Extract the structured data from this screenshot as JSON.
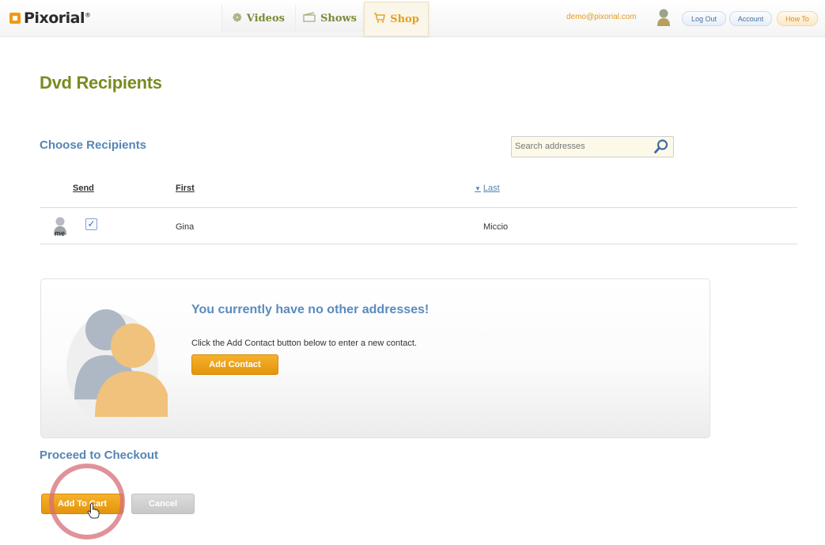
{
  "brand": {
    "name": "Pixorial",
    "reg": "®"
  },
  "nav": {
    "videos": "Videos",
    "shows": "Shows",
    "shop": "Shop"
  },
  "user": {
    "email": "demo@pixorial.com",
    "logout": "Log Out",
    "account": "Account",
    "howto": "How To"
  },
  "page": {
    "title": "Dvd Recipients"
  },
  "recipients": {
    "title": "Choose Recipients",
    "search_placeholder": "Search addresses",
    "columns": {
      "send": "Send",
      "first": "First",
      "last": "Last",
      "last_arrow": "▼"
    },
    "rows": [
      {
        "badge": "me",
        "send": true,
        "first": "Gina",
        "last": "Miccio"
      }
    ]
  },
  "empty": {
    "title": "You currently have no other addresses!",
    "description": "Click the Add Contact button below to enter a new contact.",
    "add_contact": "Add Contact"
  },
  "checkout": {
    "title": "Proceed to Checkout",
    "add_to_cart": "Add To Cart",
    "cancel": "Cancel"
  },
  "colors": {
    "accent_green": "#7a8b22",
    "link_blue": "#5585b5",
    "button_orange": "#e3950c",
    "highlight_circle": "#d66e78"
  },
  "icons": {
    "videos": "film-reel-icon",
    "shows": "clapper-icon",
    "shop": "shopping-cart-icon",
    "search": "magnifier-icon",
    "user": "user-silhouette-icon"
  }
}
